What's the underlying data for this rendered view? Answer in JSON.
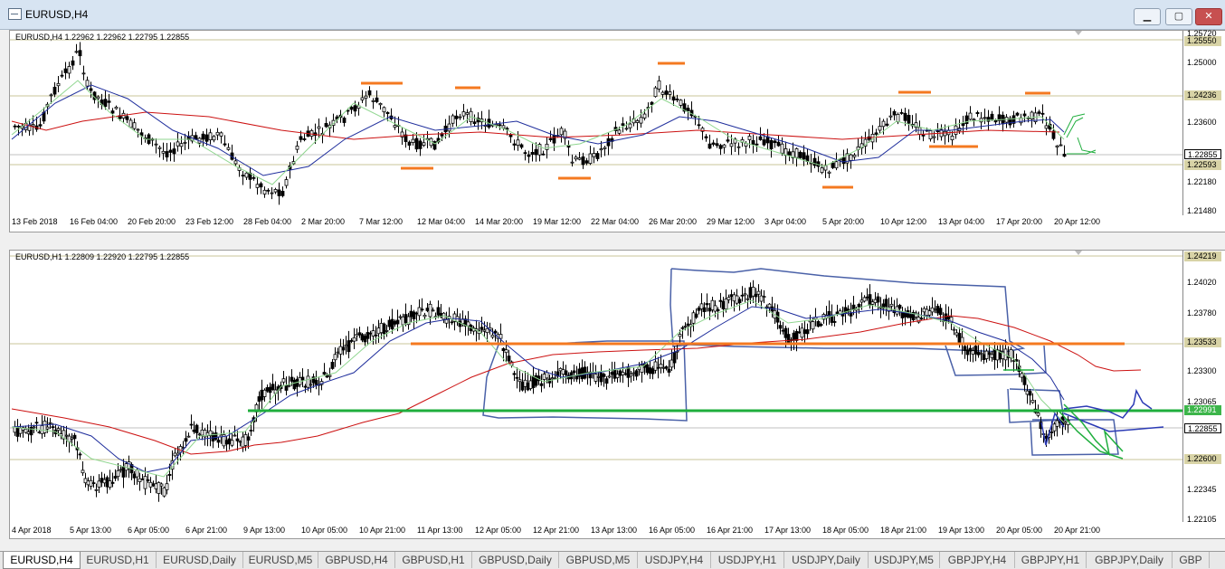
{
  "window": {
    "title": "EURUSD,H4",
    "min": "▁",
    "max": "▢",
    "close": "✕"
  },
  "colors": {
    "bg_chart": "#ffffff",
    "ma_red": "#cc1111",
    "ma_blue": "#1e2d9c",
    "ma_green": "#8fd68f",
    "level_orange": "#f47920",
    "level_green": "#1fae3d",
    "sketch_blue": "#4a61a8"
  },
  "top_chart": {
    "header": "EURUSD,H4  1.22962 1.22962 1.22795 1.22855",
    "yticks": [
      "1.25720",
      "1.25000",
      "1.23600",
      "1.22180",
      "1.21480"
    ],
    "price_labels": [
      {
        "text": "1.25550",
        "bg": "#d8d3a6"
      },
      {
        "text": "1.24236",
        "bg": "#d8d3a6"
      },
      {
        "text": "1.22855",
        "bg": "#ffffff"
      },
      {
        "text": "1.22593",
        "bg": "#d8d3a6"
      }
    ],
    "xticks": [
      "13 Feb 2018",
      "16 Feb 04:00",
      "20 Feb 20:00",
      "23 Feb 12:00",
      "28 Feb 04:00",
      "2 Mar 20:00",
      "7 Mar 12:00",
      "12 Mar 04:00",
      "14 Mar 20:00",
      "19 Mar 12:00",
      "22 Mar 04:00",
      "26 Mar 20:00",
      "29 Mar 12:00",
      "3 Apr 04:00",
      "5 Apr 20:00",
      "10 Apr 12:00",
      "13 Apr 04:00",
      "17 Apr 20:00",
      "20 Apr 12:00"
    ]
  },
  "bottom_chart": {
    "header": "EURUSD,H1  1.22809 1.22920 1.22795 1.22855",
    "yticks": [
      "1.24020",
      "1.23780",
      "1.23300",
      "1.23065",
      "1.22345",
      "1.22105"
    ],
    "price_labels": [
      {
        "text": "1.24219",
        "bg": "#d8d3a6"
      },
      {
        "text": "1.23533",
        "bg": "#d8d3a6"
      },
      {
        "text": "1.22991",
        "bg": "#3cb54a"
      },
      {
        "text": "1.22855",
        "bg": "#ffffff"
      },
      {
        "text": "1.22600",
        "bg": "#d8d3a6"
      }
    ],
    "xticks": [
      "4 Apr 2018",
      "5 Apr 13:00",
      "6 Apr 05:00",
      "6 Apr 21:00",
      "9 Apr 13:00",
      "10 Apr 05:00",
      "10 Apr 21:00",
      "11 Apr 13:00",
      "12 Apr 05:00",
      "12 Apr 21:00",
      "13 Apr 13:00",
      "16 Apr 05:00",
      "16 Apr 21:00",
      "17 Apr 13:00",
      "18 Apr 05:00",
      "18 Apr 21:00",
      "19 Apr 13:00",
      "20 Apr 05:00",
      "20 Apr 21:00"
    ]
  },
  "tabs": [
    "EURUSD,H4",
    "EURUSD,H1",
    "EURUSD,Daily",
    "EURUSD,M5",
    "GBPUSD,H4",
    "GBPUSD,H1",
    "GBPUSD,Daily",
    "GBPUSD,M5",
    "USDJPY,H4",
    "USDJPY,H1",
    "USDJPY,Daily",
    "USDJPY,M5",
    "GBPJPY,H4",
    "GBPJPY,H1",
    "GBPJPY,Daily",
    "GBP"
  ]
}
